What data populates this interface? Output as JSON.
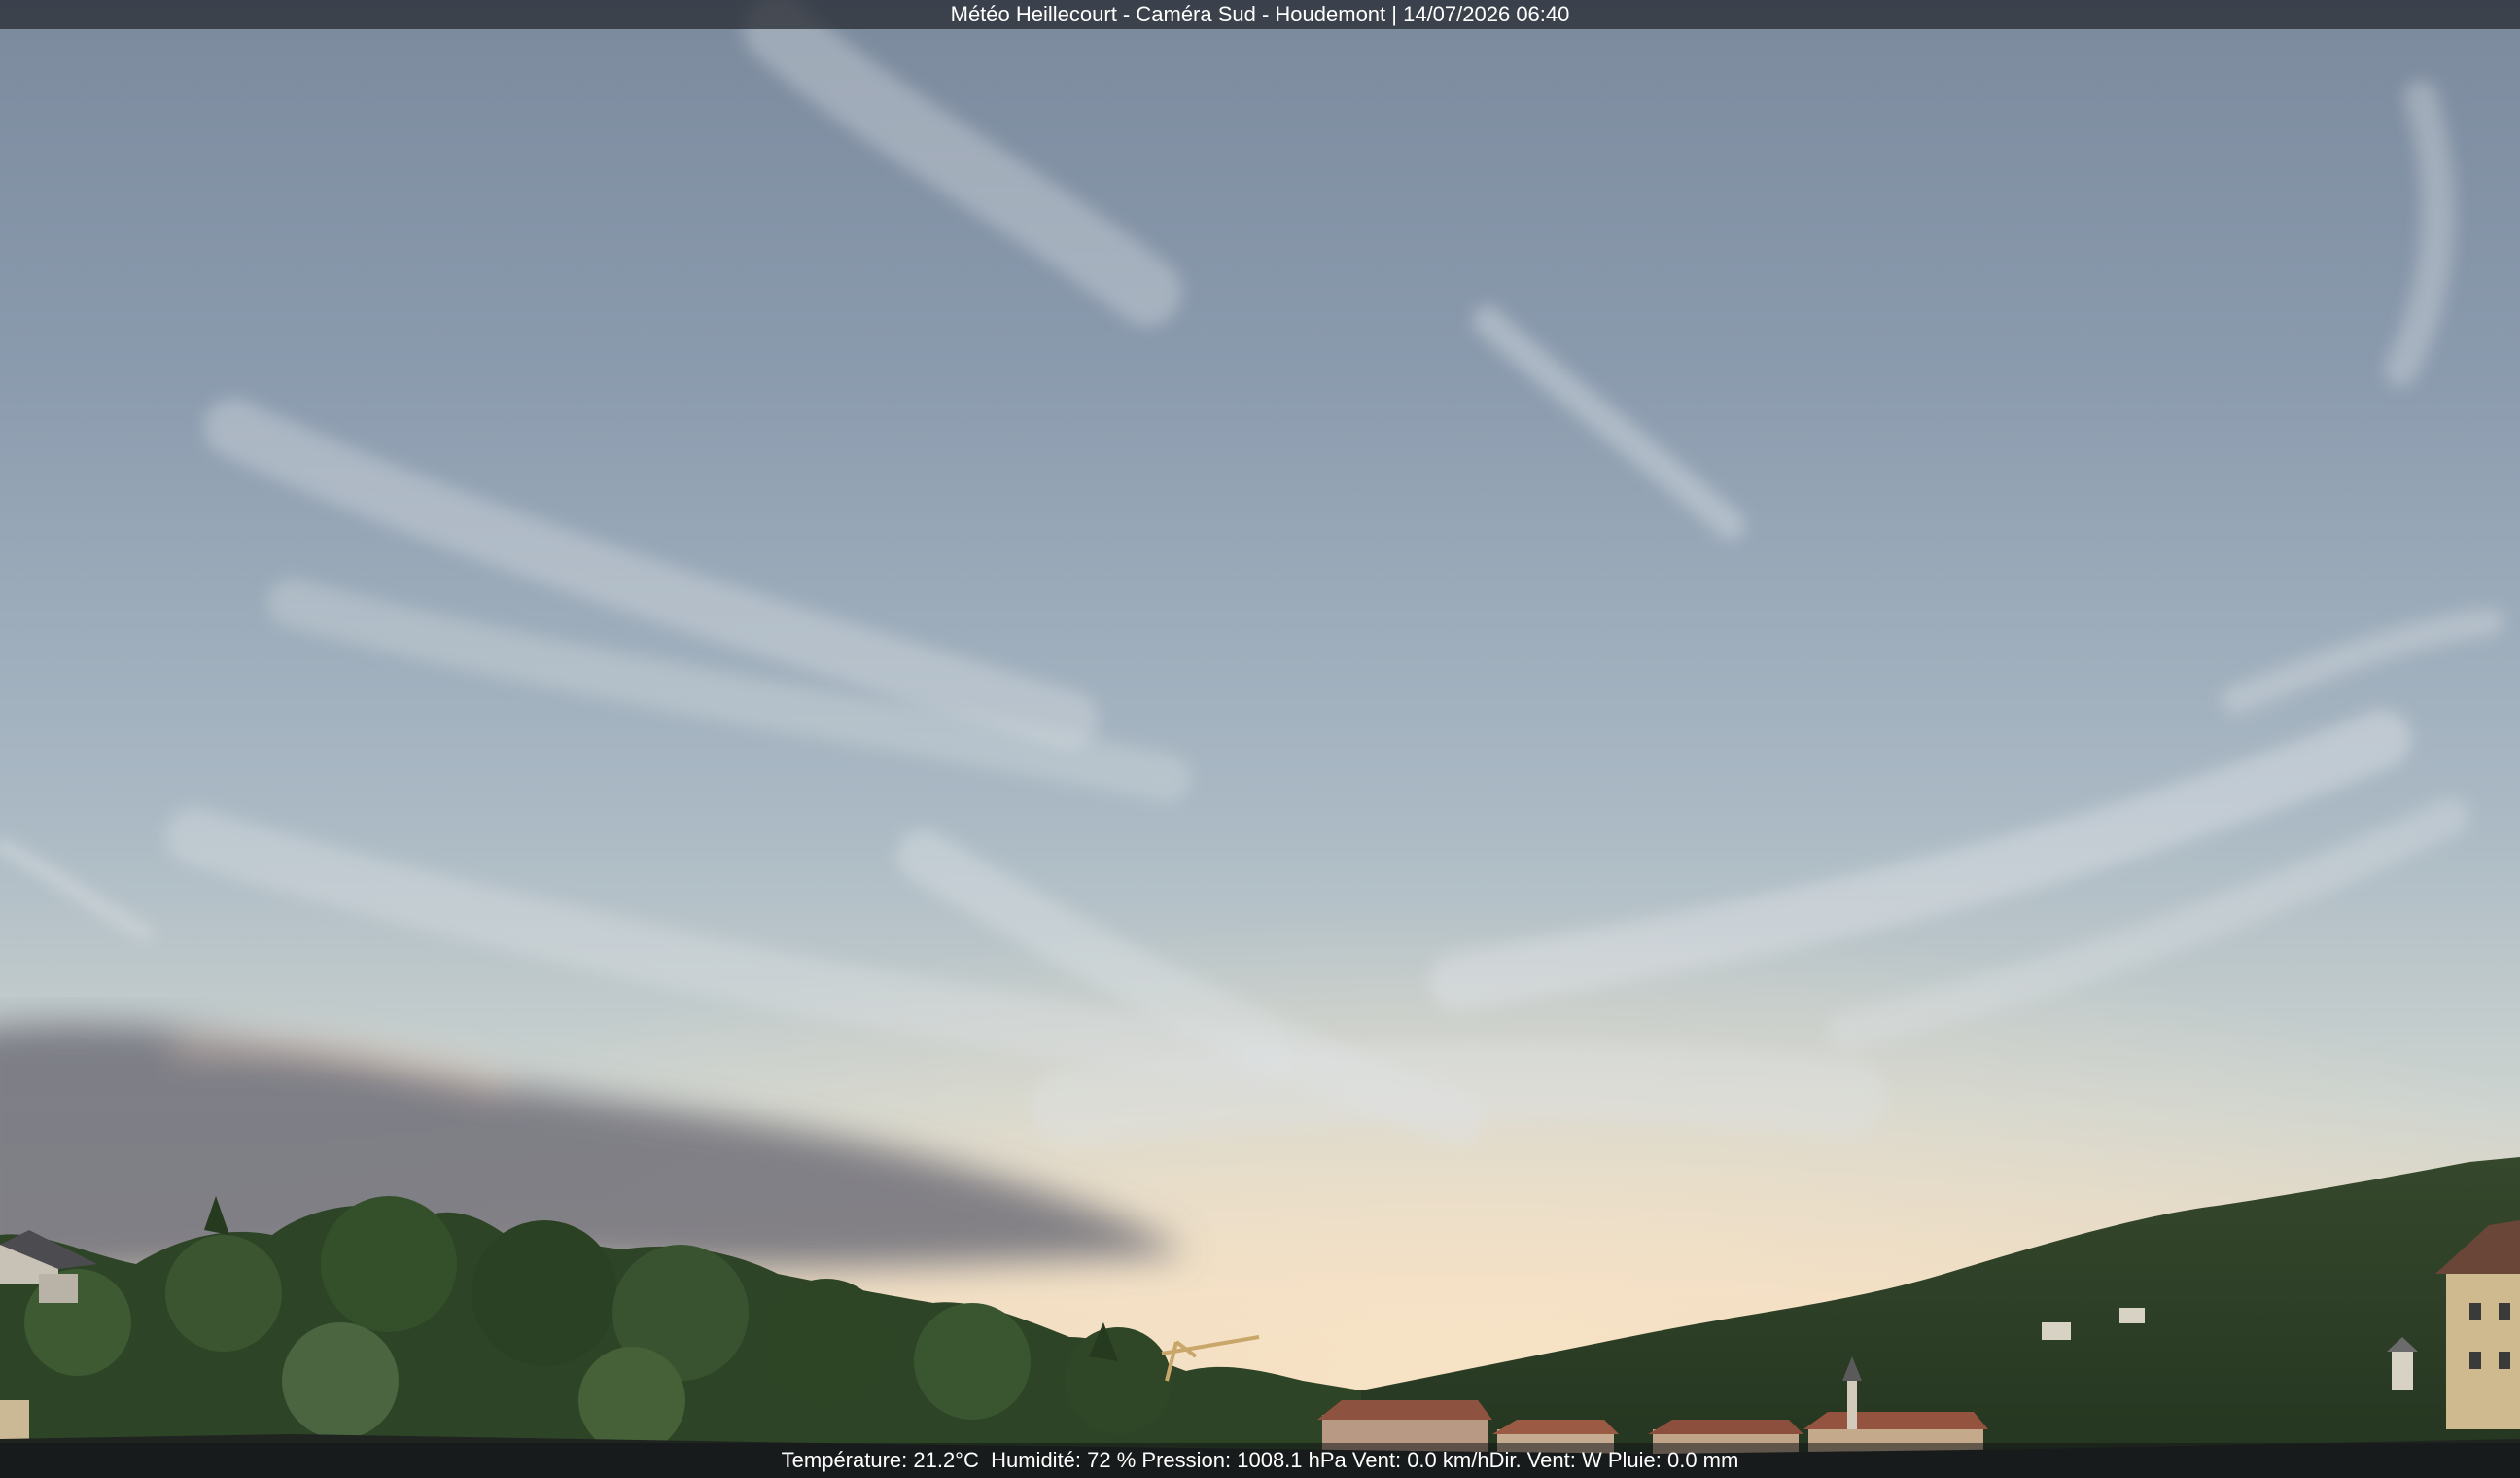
{
  "overlay": {
    "title": "Météo Heillecourt - Caméra Sud - Houdemont | 14/07/2026 06:40"
  },
  "weather": {
    "temperature": "Température: 21.2°C",
    "humidity": "Humidité: 72 %",
    "pressure": "Pression: 1008.1 hPa",
    "wind_speed": "Vent: 0.0 km/h",
    "wind_dir": "Dir. Vent: W",
    "rain": "Pluie: 0.0 mm"
  },
  "colors": {
    "sky_top": "#7d8c9f",
    "sky_mid": "#a8b7c4",
    "sky_horizon": "#f1dcc1",
    "foliage": "#2f4526",
    "building_roof": "#8e5240"
  }
}
